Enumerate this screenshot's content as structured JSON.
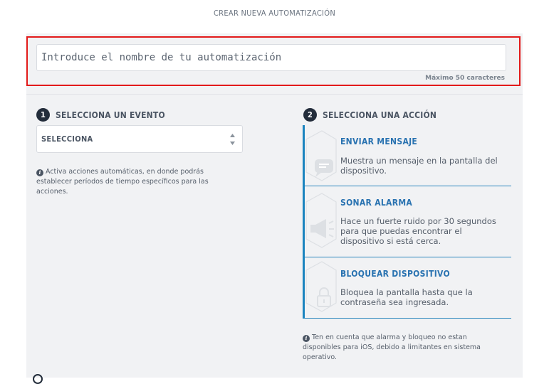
{
  "header": {
    "title": "CREAR NUEVA AUTOMATIZACIÓN"
  },
  "name_field": {
    "placeholder": "Introduce el nombre de tu automatización",
    "max_hint": "Máximo 50 caracteres"
  },
  "event_step": {
    "number": "1",
    "title": "SELECCIONA UN EVENTO",
    "select_value": "SELECCIONA",
    "note": "Activa acciones automáticas, en donde podrás establecer períodos de tiempo específicos para las acciones."
  },
  "action_step": {
    "number": "2",
    "title": "SELECCIONA UNA ACCIÓN",
    "actions": [
      {
        "title": "ENVIAR MENSAJE",
        "description": "Muestra un mensaje en la pantalla del dispositivo.",
        "icon": "message-icon"
      },
      {
        "title": "SONAR ALARMA",
        "description": "Hace un fuerte ruido por 30 segundos para que puedas encontrar el dispositivo si está cerca.",
        "icon": "megaphone-icon"
      },
      {
        "title": "BLOQUEAR DISPOSITIVO",
        "description": "Bloquea la pantalla hasta que la contraseña sea ingresada.",
        "icon": "lock-icon"
      }
    ],
    "note": "Ten en cuenta que alarma y bloqueo no estan disponibles para iOS, debido a limitantes en sistema operativo."
  },
  "colors": {
    "accent": "#1b84bf",
    "highlight_border": "#e21a1a",
    "step_badge": "#232d3b"
  }
}
